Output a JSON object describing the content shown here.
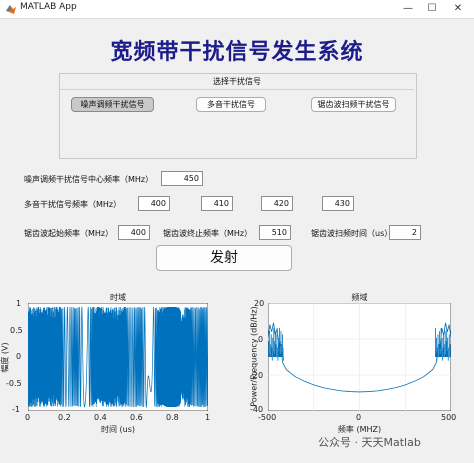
{
  "window": {
    "title": "MATLAB App",
    "minimize": "—",
    "maximize": "☐",
    "close": "✕"
  },
  "main_title": "宽频带干扰信号发生系统",
  "selector": {
    "title": "选择干扰信号",
    "buttons": [
      "噪声调频干扰信号",
      "多音干扰信号",
      "锯齿波扫频干扰信号"
    ]
  },
  "params": {
    "noise_center_label": "噪声调频干扰信号中心频率（MHz）",
    "noise_center_value": "450",
    "multitone_label": "多音干扰信号频率（MHz）",
    "multitone_values": [
      "400",
      "410",
      "420",
      "430"
    ],
    "saw_start_label": "锯齿波起始频率（MHz）",
    "saw_start_value": "400",
    "saw_stop_label": "锯齿波终止频率（MHz）",
    "saw_stop_value": "510",
    "saw_time_label": "锯齿波扫频时间（us）",
    "saw_time_value": "2"
  },
  "fire_button": "发射",
  "watermark": "公众号 · 天天Matlab",
  "chart_data": [
    {
      "type": "line",
      "title": "时域",
      "xlabel": "时间 (us)",
      "ylabel": "幅度 (V)",
      "xlim": [
        0,
        1
      ],
      "ylim": [
        -1,
        1
      ],
      "xticks": [
        "0",
        "0.2",
        "0.4",
        "0.6",
        "0.8",
        "1"
      ],
      "yticks": [
        "1",
        "0.5",
        "0",
        "-0.5",
        "-1"
      ],
      "color": "#0072bd",
      "description_series": "dense FM noise jamming waveform, amplitude ±1"
    },
    {
      "type": "line",
      "title": "频域",
      "xlabel": "频率 (MHZ)",
      "ylabel": "Power/Frequency (dB/Hz)",
      "xlim": [
        -500,
        500
      ],
      "ylim": [
        -40,
        20
      ],
      "xticks": [
        "-500",
        "0",
        "500"
      ],
      "yticks": [
        "20",
        "0",
        "-20",
        "-40"
      ],
      "color": "#0072bd",
      "x": [
        -500,
        -490,
        -480,
        -470,
        -460,
        -450,
        -440,
        -430,
        -420,
        -400,
        -350,
        -300,
        -250,
        -200,
        -150,
        -100,
        -50,
        0,
        50,
        100,
        150,
        200,
        250,
        300,
        350,
        400,
        420,
        430,
        440,
        450,
        460,
        470,
        480,
        490,
        500
      ],
      "y": [
        0,
        8,
        4,
        9,
        2,
        6,
        -5,
        -3,
        -13,
        -17,
        -21,
        -23.5,
        -25.5,
        -27,
        -28,
        -28.8,
        -29.2,
        -29.4,
        -29.2,
        -28.8,
        -28,
        -27,
        -25.5,
        -23.5,
        -21,
        -17,
        -13,
        -3,
        -5,
        6,
        2,
        9,
        4,
        8,
        0
      ]
    }
  ]
}
